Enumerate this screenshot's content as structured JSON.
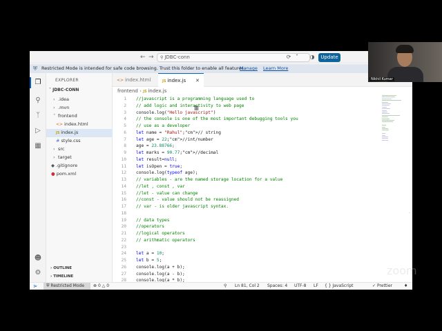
{
  "titlebar": {
    "search_text": "JDBC-conn",
    "update_label": "Update"
  },
  "banner": {
    "text": "Restricted Mode is intended for safe code browsing. Trust this folder to enable all features.",
    "manage": "Manage",
    "learn_more": "Learn More"
  },
  "sidebar": {
    "title": "EXPLORER",
    "project": "JDBC-CONN",
    "items": [
      {
        "label": ".idea",
        "type": "folder"
      },
      {
        "label": ".mvn",
        "type": "folder"
      },
      {
        "label": "frontend",
        "type": "folder-open"
      },
      {
        "label": "index.html",
        "type": "html"
      },
      {
        "label": "index.js",
        "type": "js"
      },
      {
        "label": "style.css",
        "type": "css"
      },
      {
        "label": "src",
        "type": "folder"
      },
      {
        "label": "target",
        "type": "folder"
      },
      {
        "label": ".gitignore",
        "type": "git"
      },
      {
        "label": "pom.xml",
        "type": "xml"
      }
    ],
    "outline": "OUTLINE",
    "timeline": "TIMELINE"
  },
  "tabs": [
    {
      "label": "index.html",
      "active": false
    },
    {
      "label": "index.js",
      "active": true
    }
  ],
  "breadcrumb": {
    "folder": "frontend",
    "file": "index.js"
  },
  "code_lines": [
    "//javascript is a programming language used to",
    "// add logic and interactivity to web page",
    "console.log(\"Hello javascript\")",
    "// the console is one of the most important debugging tools you",
    "// use as a developer",
    "let name = \"Rahul\";// string",
    "let age = 22;//int/number",
    "age = 23.88766;",
    "let marks = 90.77;//decimal",
    "let result=null;",
    "let isOpen = true;",
    "console.log(typeof age);",
    "// variables - are the named storage location for a value",
    "//let , const , var",
    "//let - value can change",
    "//const - value should not be reassigned",
    "// var - is older javascript syntax.",
    "",
    "// data types",
    "//operators",
    "//logical operators",
    "// arithmatic operators",
    "",
    "let a = 10;",
    "let b = 5;",
    "console.log(a + b);",
    "console.log(a - b);",
    "console.log(a * b);"
  ],
  "statusbar": {
    "restricted": "Restricted Mode",
    "errors": "0",
    "warnings": "0",
    "position": "Ln 81, Col 2",
    "spaces": "Spaces: 4",
    "encoding": "UTF-8",
    "eol": "LF",
    "language": "JavaScript",
    "prettier": "Prettier"
  },
  "webcam": {
    "name": "Nikhil Kumar"
  },
  "watermark": "zoom",
  "colors": {
    "accent": "#005fb8",
    "update_button": "#0e639c",
    "comment": "#008000",
    "keyword": "#0000ff",
    "string": "#a31515",
    "number": "#098658"
  }
}
